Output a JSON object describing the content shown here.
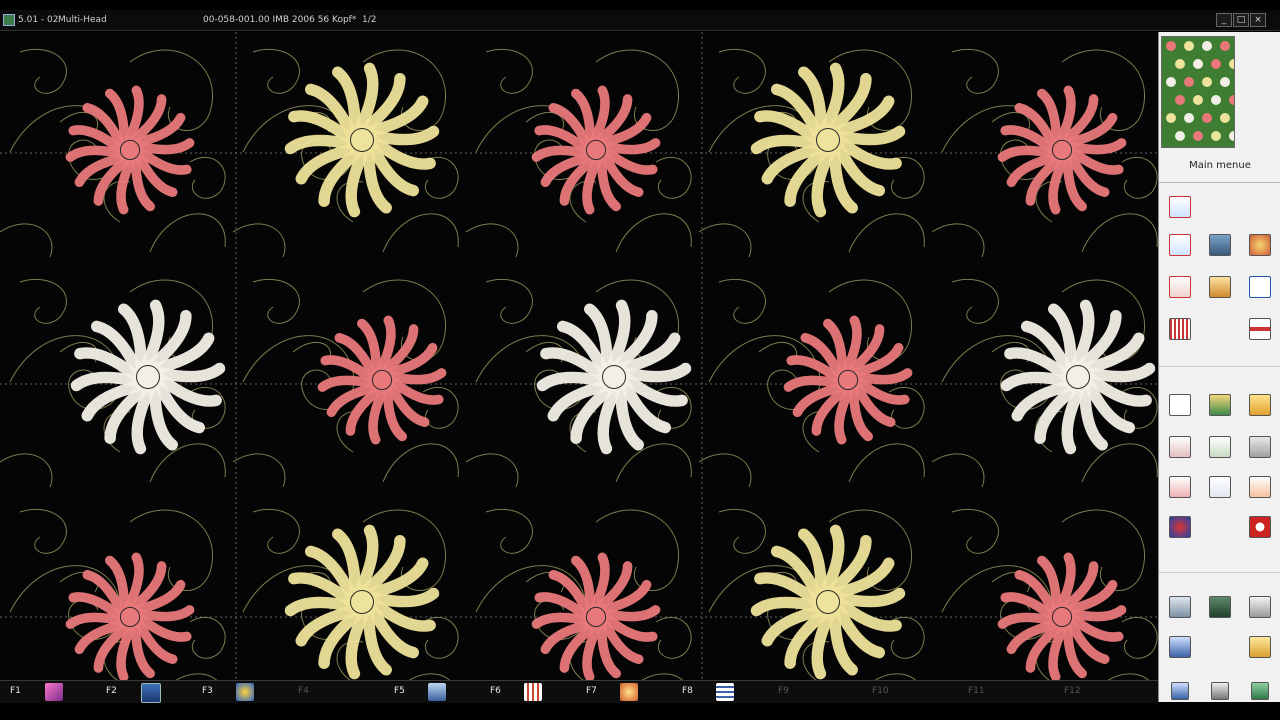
{
  "titlebar": {
    "version": "5.01 - 02",
    "mode": "Multi-Head",
    "status": "00-058-001.00  IMB 2006 56 Kopf*",
    "page": "1/2"
  },
  "window_controls": {
    "minimize": "_",
    "maximize": "□",
    "close": "×"
  },
  "side_panel": {
    "menu_title": "Main menue"
  },
  "fkeys": [
    {
      "label": "F1",
      "enabled": true
    },
    {
      "label": "F2",
      "enabled": true
    },
    {
      "label": "F3",
      "enabled": true
    },
    {
      "label": "F4",
      "enabled": false
    },
    {
      "label": "F5",
      "enabled": true
    },
    {
      "label": "F6",
      "enabled": true
    },
    {
      "label": "F7",
      "enabled": true
    },
    {
      "label": "F8",
      "enabled": true
    },
    {
      "label": "F9",
      "enabled": false
    },
    {
      "label": "F10",
      "enabled": false
    },
    {
      "label": "F11",
      "enabled": false
    },
    {
      "label": "F12",
      "enabled": false
    }
  ],
  "colors": {
    "background": "#050505",
    "flower_pink": "#e8787a",
    "flower_yellow": "#eee39a",
    "flower_white": "#f2efe6",
    "swirl_thread": "#a9a96b"
  },
  "design": {
    "motifs": [
      {
        "color": "pink"
      },
      {
        "color": "yellow"
      },
      {
        "color": "pink"
      },
      {
        "color": "yellow"
      },
      {
        "color": "pink"
      },
      {
        "color": "white"
      },
      {
        "color": "pink"
      },
      {
        "color": "white"
      },
      {
        "color": "pink"
      },
      {
        "color": "white"
      },
      {
        "color": "pink"
      },
      {
        "color": "yellow"
      },
      {
        "color": "pink"
      },
      {
        "color": "yellow"
      },
      {
        "color": "pink"
      }
    ]
  }
}
